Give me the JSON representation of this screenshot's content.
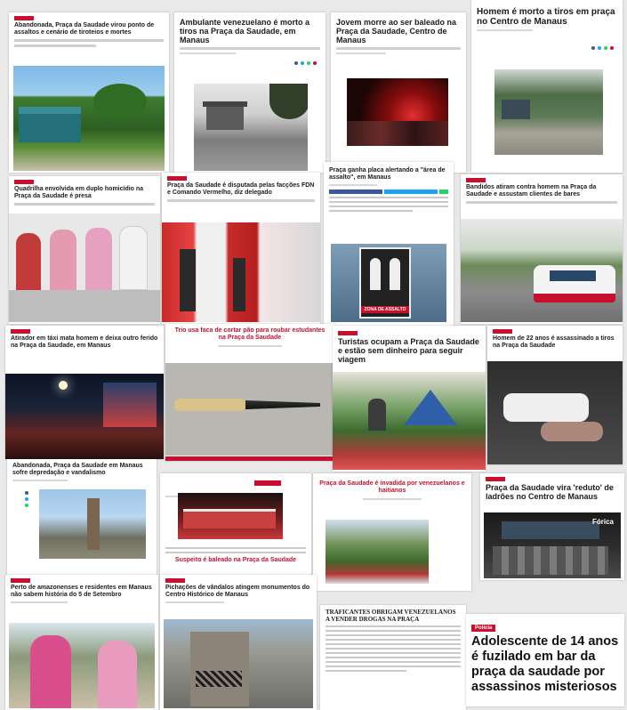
{
  "articles": [
    {
      "tag": "",
      "headline": "Abandonada, Praça da Saudade virou ponto de assaltos e cenário de tiroteios e mortes"
    },
    {
      "headline": "Ambulante venezuelano é morto a tiros na Praça da Saudade, em Manaus"
    },
    {
      "headline": "Jovem morre ao ser baleado na Praça da Saudade, Centro de Manaus"
    },
    {
      "headline": "Homem é morto a tiros em praça no Centro de Manaus"
    },
    {
      "headline": "Quadrilha envolvida em duplo homicídio na Praça da Saudade é presa"
    },
    {
      "headline": "Praça da Saudade é disputada pelas facções FDN e Comando Vermelho, diz delegado"
    },
    {
      "headline": "Praça ganha placa alertando a \"área de assalto\", em Manaus",
      "sign_text": "ZONA DE ASSALTO"
    },
    {
      "headline": "Bandidos atiram contra homem na Praça da Saudade e assustam clientes de bares"
    },
    {
      "headline": "Atirador em táxi mata homem e deixa outro ferido na Praça da Saudade, em Manaus"
    },
    {
      "headline": "Trio usa faca de cortar pão para roubar estudantes na Praça da Saudade"
    },
    {
      "headline": "Turistas ocupam a Praça da Saudade e estão sem dinheiro para seguir viagem"
    },
    {
      "headline": "Homem de 22 anos é assassinado a tiros na Praça da Saudade"
    },
    {
      "headline": "Abandonada, Praça da Saudade em Manaus sofre depredação e vandalismo"
    },
    {
      "headline": "Suspeito é baleado na Praça da Saudade"
    },
    {
      "headline": "Praça da Saudade é invadida por venezuelanos e haitianos"
    },
    {
      "headline": "Praça da Saudade vira 'reduto' de ladrões no Centro de Manaus",
      "watermark": "Fórica"
    },
    {
      "headline": "Perto de amazonenses e residentes em Manaus não sabem história do 5 de Setembro"
    },
    {
      "headline": "Pichações de vândalos atingem monumentos do Centro Histórico de Manaus"
    },
    {
      "headline": "TRAFICANTES OBRIGAM VENEZUELANOS A VENDER DROGAS NA PRAÇA"
    },
    {
      "tag": "Polícia",
      "headline": "Adolescente de 14 anos é fuzilado em bar da praça da saudade por assassinos misteriosos"
    }
  ],
  "colors": {
    "accent": "#c8102e",
    "background": "#e9e9e9",
    "card": "#ffffff"
  }
}
